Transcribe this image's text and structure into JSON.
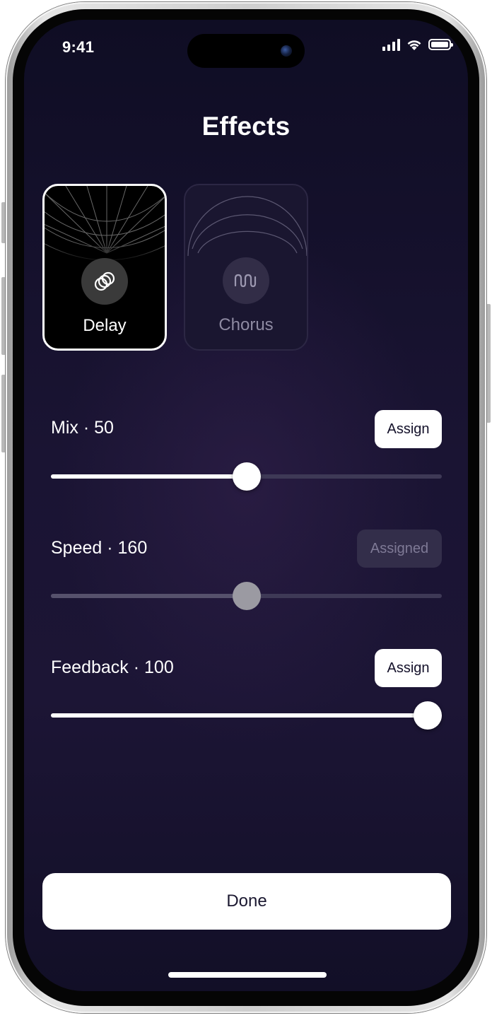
{
  "status_bar": {
    "time": "9:41",
    "icons": [
      "cellular-signal-icon",
      "wifi-icon",
      "battery-icon"
    ]
  },
  "header": {
    "title": "Effects"
  },
  "effects": [
    {
      "label": "Delay",
      "icon": "rings-icon",
      "selected": true
    },
    {
      "label": "Chorus",
      "icon": "wave-icon",
      "selected": false
    }
  ],
  "params": [
    {
      "label": "Mix · 50",
      "button": "Assign",
      "assigned": false,
      "value_fraction": 0.5
    },
    {
      "label": "Speed · 160",
      "button": "Assigned",
      "assigned": true,
      "value_fraction": 0.5
    },
    {
      "label": "Feedback · 100",
      "button": "Assign",
      "assigned": false,
      "value_fraction": 1.0
    }
  ],
  "footer": {
    "done_label": "Done"
  },
  "colors": {
    "background": "#1a1433",
    "accent": "#ffffff",
    "muted": "#332e4a"
  }
}
